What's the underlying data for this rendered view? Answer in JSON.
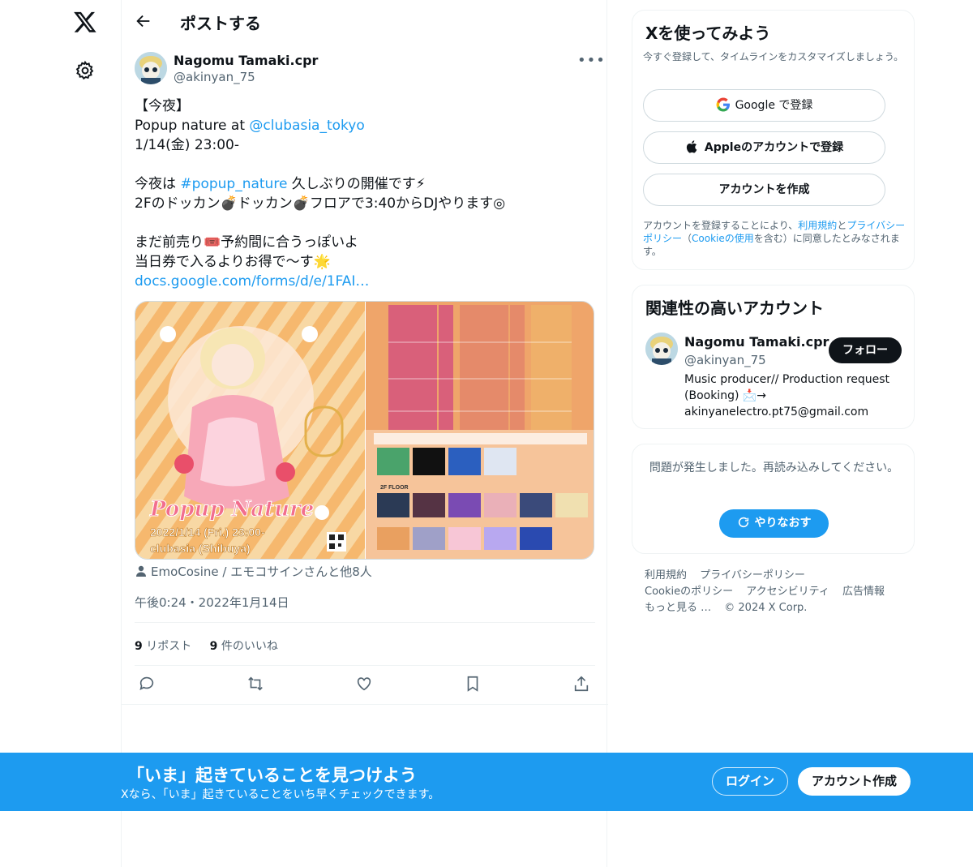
{
  "brand": {
    "accent": "#1d9bf0",
    "text": "#0f1419",
    "muted": "#536471"
  },
  "left_rail": {
    "logo_icon": "x-logo-icon",
    "settings_icon": "gear-icon"
  },
  "header": {
    "title": "ポストする",
    "back_icon": "arrow-left-icon"
  },
  "tweet": {
    "author": {
      "name": "Nagomu Tamaki.cpr",
      "handle": "@akinyan_75"
    },
    "lines": {
      "l1": "【今夜】",
      "l2_pre": "Popup nature at ",
      "l2_mention": "@clubasia_tokyo",
      "l3": "1/14(金) 23:00-",
      "l5_pre": "今夜は ",
      "l5_tag": "#popup_nature",
      "l5_post": " 久しぶりの開催です⚡",
      "l6": "2Fのドッカン💣ドッカン💣フロアで3:40からDJやります◎",
      "l8": "まだ前売り🎟️予約間に合うっぽいよ",
      "l9": "当日券で入るよりお得で〜す🌟",
      "l10_link": "docs.google.com/forms/d/e/1FAI…"
    },
    "poster": {
      "title": "Popup Nature",
      "date": "2022/1/14 (Fri.) 23:00-",
      "venue": "clubasia (Shibuya)",
      "floor_label": "2F FLOOR"
    },
    "tagged": "EmoCosine / エモコサインさんと他8人",
    "timestamp": "午後0:24・2022年1月14日",
    "stats": {
      "reposts_count": "9",
      "reposts_label": "リポスト",
      "likes_count": "9",
      "likes_label": "件のいいね"
    },
    "actions": [
      "reply-icon",
      "repost-icon",
      "like-icon",
      "bookmark-icon",
      "share-icon"
    ]
  },
  "signup_panel": {
    "title": "Xを使ってみよう",
    "subtitle": "今すぐ登録して、タイムラインをカスタマイズしましょう。",
    "google_label": "Google で登録",
    "apple_label": "Appleのアカウントで登録",
    "create_label": "アカウントを作成",
    "legal_pre": "アカウントを登録することにより、",
    "legal_terms": "利用規約",
    "legal_and": "と",
    "legal_privacy": "プライバシーポリシー",
    "legal_mid": "（",
    "legal_cookie": "Cookieの使用",
    "legal_post": "を含む）に同意したとみなされます。"
  },
  "related_panel": {
    "title": "関連性の高いアカウント",
    "name": "Nagomu Tamaki.cpr",
    "handle": "@akinyan_75",
    "follow_label": "フォロー",
    "bio": "Music producer// Production request (Booking) 📩→ akinyanelectro.pt75@gmail.com"
  },
  "error_panel": {
    "message": "問題が発生しました。再読み込みしてください。",
    "retry_label": "やりなおす"
  },
  "footer": {
    "terms": "利用規約",
    "privacy": "プライバシーポリシー",
    "cookie": "Cookieのポリシー",
    "accessibility": "アクセシビリティ",
    "ads": "広告情報",
    "more": "もっと見る …",
    "copyright": "© 2024 X Corp."
  },
  "bottom_banner": {
    "title": "「いま」起きていることを見つけよう",
    "subtitle": "Xなら、「いま」起きていることをいち早くチェックできます。",
    "login_label": "ログイン",
    "signup_label": "アカウント作成"
  }
}
